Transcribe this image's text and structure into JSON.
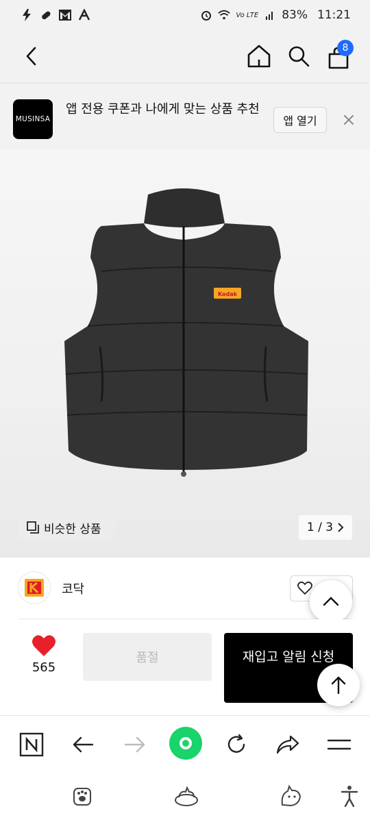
{
  "status_bar": {
    "battery": "83%",
    "time": "11:21",
    "carrier": "Vo LTE"
  },
  "nav": {
    "cart_count": "8"
  },
  "app_banner": {
    "logo_text": "MUSINSA",
    "message": "앱 전용 쿠폰과 나에게 맞는 상품 추천",
    "open_label": "앱 열기"
  },
  "product": {
    "similar_label": "비슷한 상품",
    "pager": "1 / 3",
    "patch_text": "Kodak"
  },
  "brand": {
    "name": "코닥"
  },
  "purchase": {
    "like_count": "565",
    "soldout_label": "품절",
    "restock_label": "재입고 알림 신청"
  },
  "colors": {
    "accent": "#1f6bff",
    "heart": "#e8202a",
    "green": "#19d36b"
  }
}
